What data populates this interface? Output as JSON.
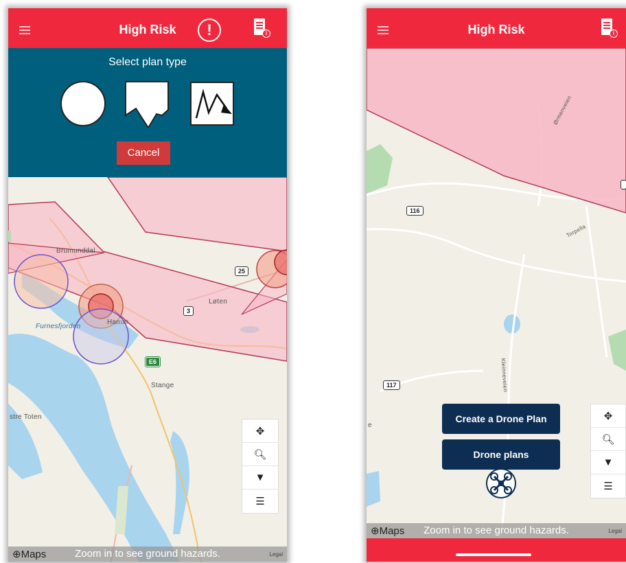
{
  "left_screen": {
    "header": {
      "title": "High Risk",
      "alert_icon": "!",
      "badge_icon": "i"
    },
    "plan_panel": {
      "title": "Select plan type",
      "options": [
        "circle",
        "polygon",
        "route"
      ],
      "cancel_label": "Cancel"
    },
    "map": {
      "places": [
        "Brumunddal",
        "Løten",
        "Furnesfjorden",
        "Hamar",
        "Stange",
        "stre Toten"
      ],
      "roads": [
        "25",
        "3",
        "E6"
      ]
    },
    "tools": [
      "crosshair-icon",
      "search-icon",
      "filter-icon",
      "list-icon"
    ],
    "bottom": {
      "logo": "Maps",
      "hint": "Zoom in to see ground hazards.",
      "legal": "Legal"
    }
  },
  "right_screen": {
    "header": {
      "title": "High Risk",
      "badge_icon": "i"
    },
    "map": {
      "places": [
        "Ørmenveien",
        "Torpella",
        "Kleinneveien",
        "e"
      ],
      "roads": [
        "116",
        "117"
      ]
    },
    "buttons": {
      "create": "Create a Drone Plan",
      "plans": "Drone plans"
    },
    "tools": [
      "crosshair-icon",
      "search-icon",
      "filter-icon",
      "list-icon"
    ],
    "bottom": {
      "logo": "Maps",
      "hint": "Zoom in to see ground hazards.",
      "legal": "Legal"
    }
  },
  "colors": {
    "header_red": "#f0283e",
    "panel_teal": "#005f7c",
    "navy": "#0d2d52",
    "risk_zone": "#f7b6c4"
  }
}
